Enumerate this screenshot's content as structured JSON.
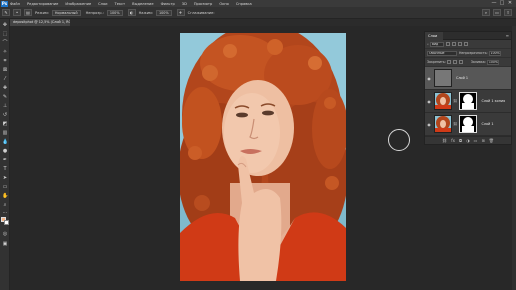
{
  "app": {
    "icon_text": "Ps"
  },
  "menu": {
    "items": [
      "Файл",
      "Редактирование",
      "Изображение",
      "Слои",
      "Текст",
      "Выделение",
      "Фильтр",
      "3D",
      "Просмотр",
      "Окно",
      "Справка"
    ],
    "window_controls": [
      "—",
      "□",
      "✕"
    ]
  },
  "options": {
    "mode_label": "Режим:",
    "mode_value": "Нормальный",
    "opacity_label": "Непрозр.:",
    "opacity_value": "100%",
    "pressure_label": "Нажим:",
    "pressure_value": "100%",
    "smoothing_label": "Сглаживание:"
  },
  "document": {
    "tab_title": "depositphot @ 12,5% (Слой 1, RGB/8) *"
  },
  "layers_panel": {
    "tab_label": "Слои",
    "filter_label": "Вид",
    "blend_mode": "Обычные",
    "opacity_label": "Непрозрачность:",
    "opacity_value": "100%",
    "lock_label": "Закрепить:",
    "fill_label": "Заливка:",
    "fill_value": "100%",
    "layers": [
      {
        "name": "Слой 1",
        "selected": true
      },
      {
        "name": "Слой 1 копия",
        "selected": false
      },
      {
        "name": "Слой 1",
        "selected": false
      }
    ]
  },
  "colors": {
    "foreground": "#f4b183",
    "background": "#ffffff",
    "selected_layer": "#575757"
  }
}
